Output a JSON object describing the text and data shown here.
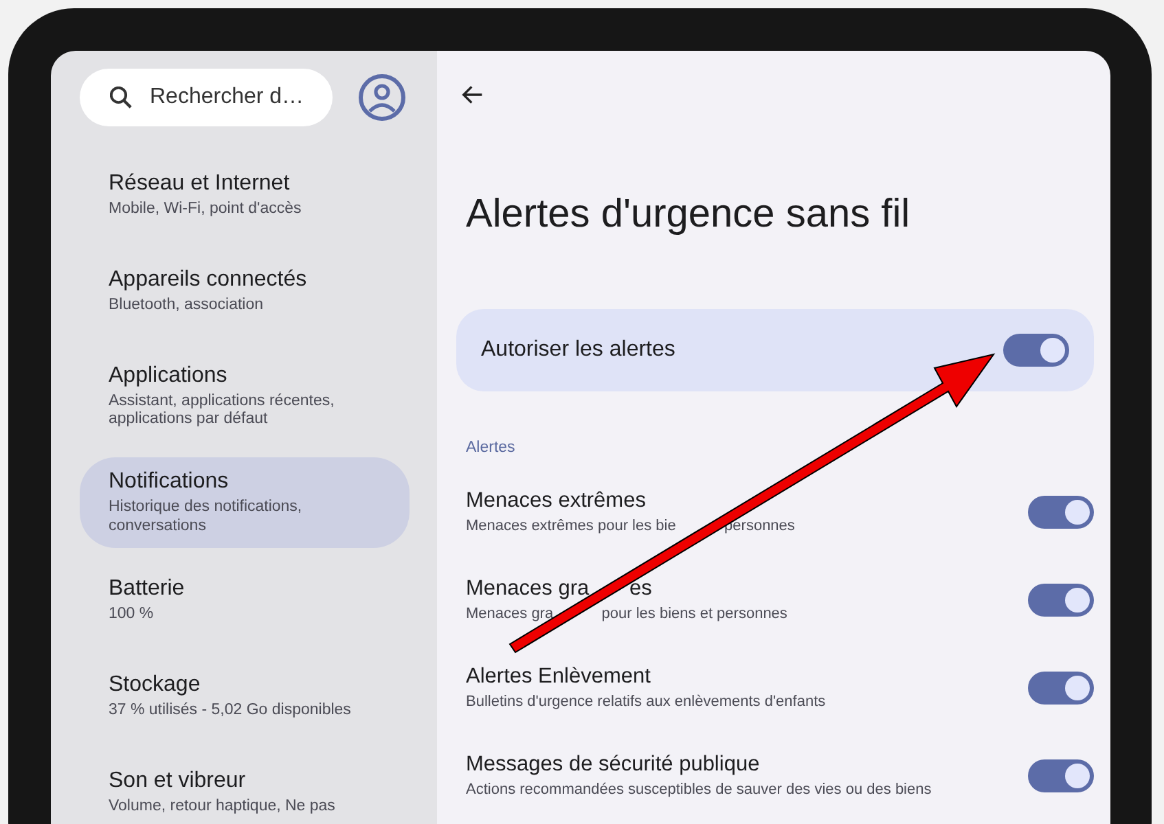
{
  "search": {
    "placeholder": "Rechercher d…"
  },
  "sidebar": {
    "items": [
      {
        "title": "Réseau et Internet",
        "subtitle": "Mobile, Wi-Fi, point d'accès",
        "selected": false
      },
      {
        "title": "Appareils connectés",
        "subtitle": "Bluetooth, association",
        "selected": false
      },
      {
        "title": "Applications",
        "subtitle": "Assistant, applications récentes, applications par défaut",
        "selected": false
      },
      {
        "title": "Notifications",
        "subtitle": "Historique des notifications, conversations",
        "selected": true
      },
      {
        "title": "Batterie",
        "subtitle": "100 %",
        "selected": false
      },
      {
        "title": "Stockage",
        "subtitle": "37 % utilisés - 5,02 Go disponibles",
        "selected": false
      },
      {
        "title": "Son et vibreur",
        "subtitle": "Volume, retour haptique, Ne pas",
        "selected": false
      }
    ]
  },
  "page": {
    "title": "Alertes d'urgence sans fil",
    "main_toggle": {
      "label": "Autoriser les alertes",
      "on": true
    },
    "section": "Alertes",
    "settings": [
      {
        "title_parts": [
          "Menaces extrêmes"
        ],
        "subtitle_parts": [
          "Menaces extrêmes pour les bie",
          "personnes"
        ],
        "on": true
      },
      {
        "title_parts": [
          "Menaces gra",
          "es"
        ],
        "subtitle_parts": [
          "Menaces gra",
          "pour les biens et personnes"
        ],
        "on": true
      },
      {
        "title_parts": [
          "Alertes Enlèvement"
        ],
        "subtitle_parts": [
          "Bulletins d'urgence relatifs aux enlèvements d'enfants"
        ],
        "on": true
      },
      {
        "title_parts": [
          "Messages de sécurité publique"
        ],
        "subtitle_parts": [
          "Actions recommandées susceptibles de sauver des vies ou des biens"
        ],
        "on": true
      }
    ]
  }
}
